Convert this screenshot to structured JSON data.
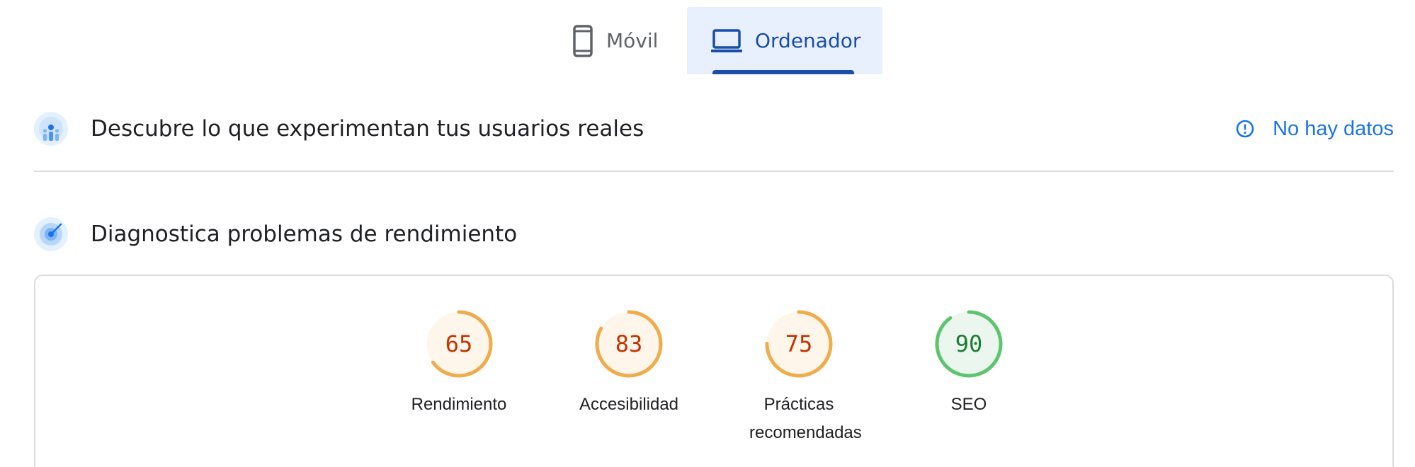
{
  "tabs": [
    {
      "label": "Móvil",
      "icon": "phone-icon",
      "selected": false
    },
    {
      "label": "Ordenador",
      "icon": "laptop-icon",
      "selected": true
    }
  ],
  "field_data": {
    "title": "Descubre lo que experimentan tus usuarios reales",
    "icon": "users-chart-icon",
    "status": "No hay datos",
    "status_icon": "info-icon"
  },
  "lab_data": {
    "title": "Diagnostica problemas de rendimiento",
    "icon": "target-icon"
  },
  "scores": [
    {
      "label": "Rendimiento",
      "value": 65,
      "color": "#f0ab4a",
      "text_color": "#c33300",
      "bg": "#fef6ea"
    },
    {
      "label": "Accesibilidad",
      "value": 83,
      "color": "#f0ab4a",
      "text_color": "#c33300",
      "bg": "#fef6ea"
    },
    {
      "label": "Prácticas recomendadas",
      "value": 75,
      "color": "#f0ab4a",
      "text_color": "#c33300",
      "bg": "#fef6ea"
    },
    {
      "label": "SEO",
      "value": 90,
      "color": "#5ec46e",
      "text_color": "#1c7a32",
      "bg": "#ebf7ee"
    }
  ]
}
